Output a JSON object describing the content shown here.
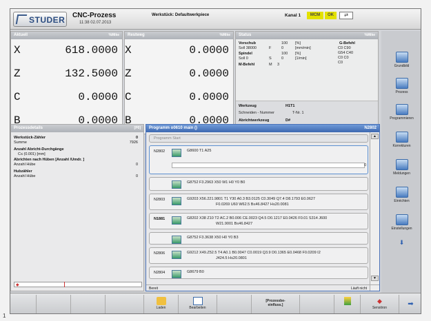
{
  "header": {
    "logo": "STUDER",
    "title": "CNC-Prozess",
    "datetime": "11:38 02.07.2013",
    "workpiece": "Werkstück: Defaultwerkpiece",
    "channel": "Kanal 1",
    "mcm": "MCM",
    "ok": "OK"
  },
  "actual": {
    "title": "Aktuell",
    "unit": "%Mike",
    "rows": [
      {
        "axis": "X",
        "value": "618.0000"
      },
      {
        "axis": "Z",
        "value": "132.5000"
      },
      {
        "axis": "C",
        "value": "0.0000"
      },
      {
        "axis": "B",
        "value": "0.0000"
      }
    ]
  },
  "rest": {
    "title": "Restweg",
    "unit": "%Mike",
    "rows": [
      {
        "axis": "X",
        "value": "0.0000"
      },
      {
        "axis": "Z",
        "value": "0.0000"
      },
      {
        "axis": "C",
        "value": "0.0000"
      },
      {
        "axis": "B",
        "value": "0.0000"
      }
    ]
  },
  "status": {
    "title": "Status",
    "unit": "%Mike",
    "vorschub": "Vorschub",
    "vor_val": "100",
    "vor_pct": "[%]",
    "vor_soll": "Soll 38000",
    "vor_f": "F",
    "vor_f_val": "0",
    "vor_unit": "[mm/min]",
    "spindel": "Spindel",
    "sp_val": "100",
    "sp_pct": "[%]",
    "sp_soll": "Soll 0",
    "sp_s": "S",
    "sp_s_val": "0",
    "sp_unit": "[1/min]",
    "mbefehl": "M-Befehl",
    "m_m": "M",
    "m_val": "3",
    "gbefehl": "G-Befehl",
    "g1": "C0    C90",
    "g2": "G54   C40",
    "g3": "C0    C0",
    "g4": "C0",
    "werkzeug": "Werkzeug",
    "wz_val": "H1T1",
    "schneiden": "Schneiden - Nummer",
    "sn_val": "T-Nr. 1",
    "abricht": "Abrichtwerkzeug",
    "ab_val": "D#"
  },
  "sidebar": [
    {
      "label": "Grundbild"
    },
    {
      "label": "Prozess"
    },
    {
      "label": "Programmieren"
    },
    {
      "label": "Korrekturen"
    },
    {
      "label": "Meldungen"
    },
    {
      "label": "Einrichten"
    },
    {
      "label": "Einstellungen"
    }
  ],
  "details": {
    "title": "Prozessdetails",
    "badge": "[P0]",
    "counter": "Werkstück-Zähler",
    "counter_val": "0",
    "sum": "Summe",
    "sum_val": "7926",
    "abricht_count": "Anzahl Abricht-Durchgänge",
    "abricht_sub": "C≤ (0.001)   [mm]",
    "abricht_hub": "Abrichten nach Hüben [Anzahl /Umdr. ]",
    "hub1": "Anzahl Hübe",
    "hub1_val": "0",
    "hubzahler": "Hubzähler",
    "hub2": "Anzahl Hübe",
    "hub2_val": "0"
  },
  "program": {
    "title": "Programm o0610 main ()",
    "block": "N2802",
    "start": "Programm Start",
    "lines": [
      {
        "n": "N2802",
        "code": "G8600 T1 A25",
        "extra": "0"
      },
      {
        "n": "",
        "code": "G8752 F3.2963 X50 W1 H0 Y0 B0"
      },
      {
        "n": "N2803",
        "code": "G9203 X56.221.9801 T1 Y30 A0.3 B3.0125 C0.3049 Q7.4 D8.1793 E0.0627",
        "code2": "F0.0269 U60 W62.5 B≤46.8427 H≤20.0081"
      },
      {
        "n": "N1881",
        "code": "G8202 X38 Z10 T2 AC.2 B0.006 CE.0023 Q4.5 D0.1217 E0.0426 F0.01 S314 J600",
        "code2": "W21.9001 B≤46.8427"
      },
      {
        "n": "",
        "code": "G8752 F3.3638 X50 H0 Y0 B3"
      },
      {
        "n": "N2806",
        "code": "G9212 X49.Z52.5 T4 A0.1 B0.0047 C0.0019 Q3.9 D0.1365 E0.0468 F0.0209 I2",
        "code2": "J424.5 H≤20.0801"
      },
      {
        "n": "N2804",
        "code": "G8679 B0"
      }
    ],
    "ready": "Bereit",
    "running": "Läuft nicht"
  },
  "footer": {
    "laden": "Laden",
    "bearbeiten": "Bearbeiten",
    "prozess": "[Prozessbe-",
    "prozess2": "einfluss.]",
    "sensitron": "Sensitron"
  },
  "corner": "1",
  "colors": {
    "accent": "#3d68b0",
    "yellow": "#e3e100"
  }
}
